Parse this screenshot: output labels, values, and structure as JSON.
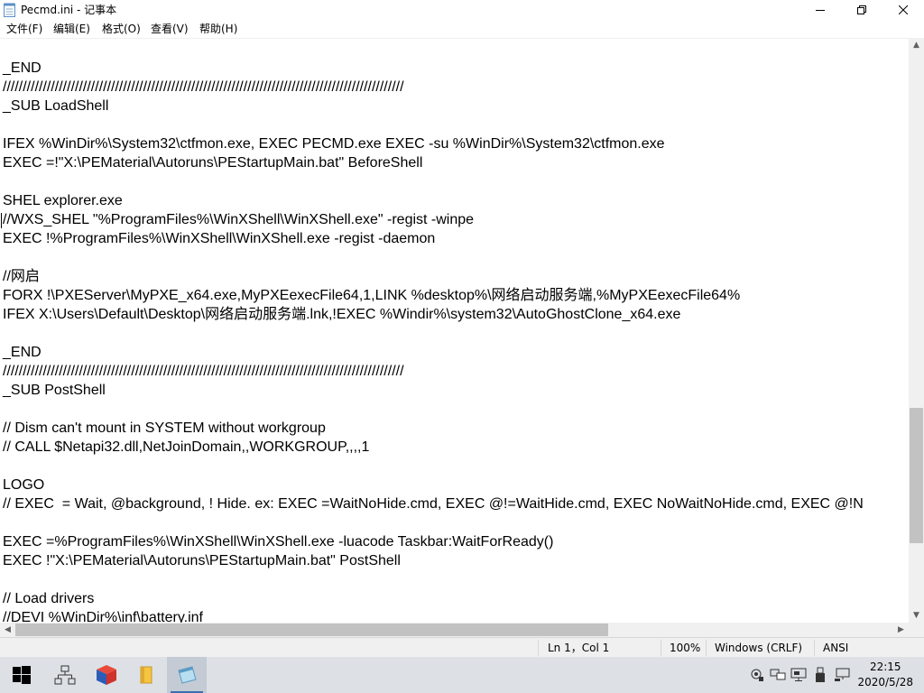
{
  "window": {
    "title": "Pecmd.ini - 记事本",
    "app_icon": "notepad-icon",
    "controls": {
      "minimize": "minimize-icon",
      "maximize": "maximize-icon",
      "close": "close-icon"
    }
  },
  "menu": [
    "文件(F)",
    "编辑(E)",
    "格式(O)",
    "查看(V)",
    "帮助(H)"
  ],
  "editor": {
    "lines": [
      "_END",
      "////////////////////////////////////////////////////////////////////////////////////////////////////",
      "_SUB LoadShell",
      "",
      "IFEX %WinDir%\\System32\\ctfmon.exe, EXEC PECMD.exe EXEC -su %WinDir%\\System32\\ctfmon.exe",
      "EXEC =!\"X:\\PEMaterial\\Autoruns\\PEStartupMain.bat\" BeforeShell",
      "",
      "SHEL explorer.exe",
      "//WXS_SHEL \"%ProgramFiles%\\WinXShell\\WinXShell.exe\" -regist -winpe",
      "EXEC !%ProgramFiles%\\WinXShell\\WinXShell.exe -regist -daemon",
      "",
      "//网启",
      "FORX !\\PXEServer\\MyPXE_x64.exe,MyPXEexecFile64,1,LINK %desktop%\\网络启动服务端,%MyPXEexecFile64%",
      "IFEX X:\\Users\\Default\\Desktop\\网络启动服务端.lnk,!EXEC %Windir%\\system32\\AutoGhostClone_x64.exe",
      "",
      "_END",
      "////////////////////////////////////////////////////////////////////////////////////////////////////",
      "_SUB PostShell",
      "",
      "// Dism can't mount in SYSTEM without workgroup",
      "// CALL $Netapi32.dll,NetJoinDomain,,WORKGROUP,,,,1",
      "",
      "LOGO",
      "// EXEC  = Wait, @background, ! Hide. ex: EXEC =WaitNoHide.cmd, EXEC @!=WaitHide.cmd, EXEC NoWaitNoHide.cmd, EXEC @!N",
      "",
      "EXEC =%ProgramFiles%\\WinXShell\\WinXShell.exe -luacode Taskbar:WaitForReady()",
      "EXEC !\"X:\\PEMaterial\\Autoruns\\PEStartupMain.bat\" PostShell",
      "",
      "// Load drivers",
      "//DEVI %WinDir%\\inf\\battery.inf"
    ]
  },
  "status": {
    "position": "Ln 1，Col 1",
    "zoom": "100%",
    "line_ending": "Windows (CRLF)",
    "encoding": "ANSI"
  },
  "taskbar": {
    "apps": [
      "start-icon",
      "network-app-icon",
      "3d-box-app-icon",
      "folder-icon",
      "notepad-icon"
    ],
    "tray": [
      "network-status-icon",
      "display-icon",
      "monitor-icon",
      "usb-icon",
      "network-icon"
    ],
    "time": "22:15",
    "date": "2020/5/28"
  },
  "colors": {
    "taskbar": "#dde1e6",
    "scroll_thumb": "#c2c2c2"
  }
}
